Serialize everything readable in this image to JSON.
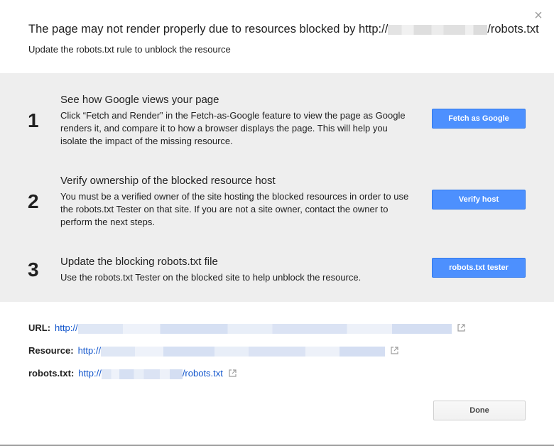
{
  "dialog": {
    "close_icon": "×",
    "title_prefix": "The page may not render properly due to resources blocked by http://",
    "title_suffix": "/robots.txt",
    "subtitle": "Update the robots.txt rule to unblock the resource"
  },
  "steps": [
    {
      "number": "1",
      "title": "See how Google views your page",
      "body": "Click “Fetch and Render” in the Fetch-as-Google feature to view the page as Google renders it, and compare it to how a browser displays the page. This will help you isolate the impact of the missing resource.",
      "button": "Fetch as Google"
    },
    {
      "number": "2",
      "title": "Verify ownership of the blocked resource host",
      "body": "You must be a verified owner of the site hosting the blocked resources in order to use the robots.txt Tester on that site. If you are not a site owner, contact the owner to perform the next steps.",
      "button": "Verify host"
    },
    {
      "number": "3",
      "title": "Update the blocking robots.txt file",
      "body": "Use the robots.txt Tester on the blocked site to help unblock the resource.",
      "button": "robots.txt tester"
    }
  ],
  "info": {
    "url_label": "URL:",
    "url_prefix": "http://",
    "resource_label": "Resource:",
    "resource_prefix": "http://",
    "robots_label": "robots.txt:",
    "robots_prefix": "http://",
    "robots_suffix": "/robots.txt"
  },
  "footer": {
    "done_label": "Done"
  },
  "colors": {
    "primary_button": "#4d90fe",
    "link": "#1155cc",
    "steps_background": "#eeeeee"
  }
}
